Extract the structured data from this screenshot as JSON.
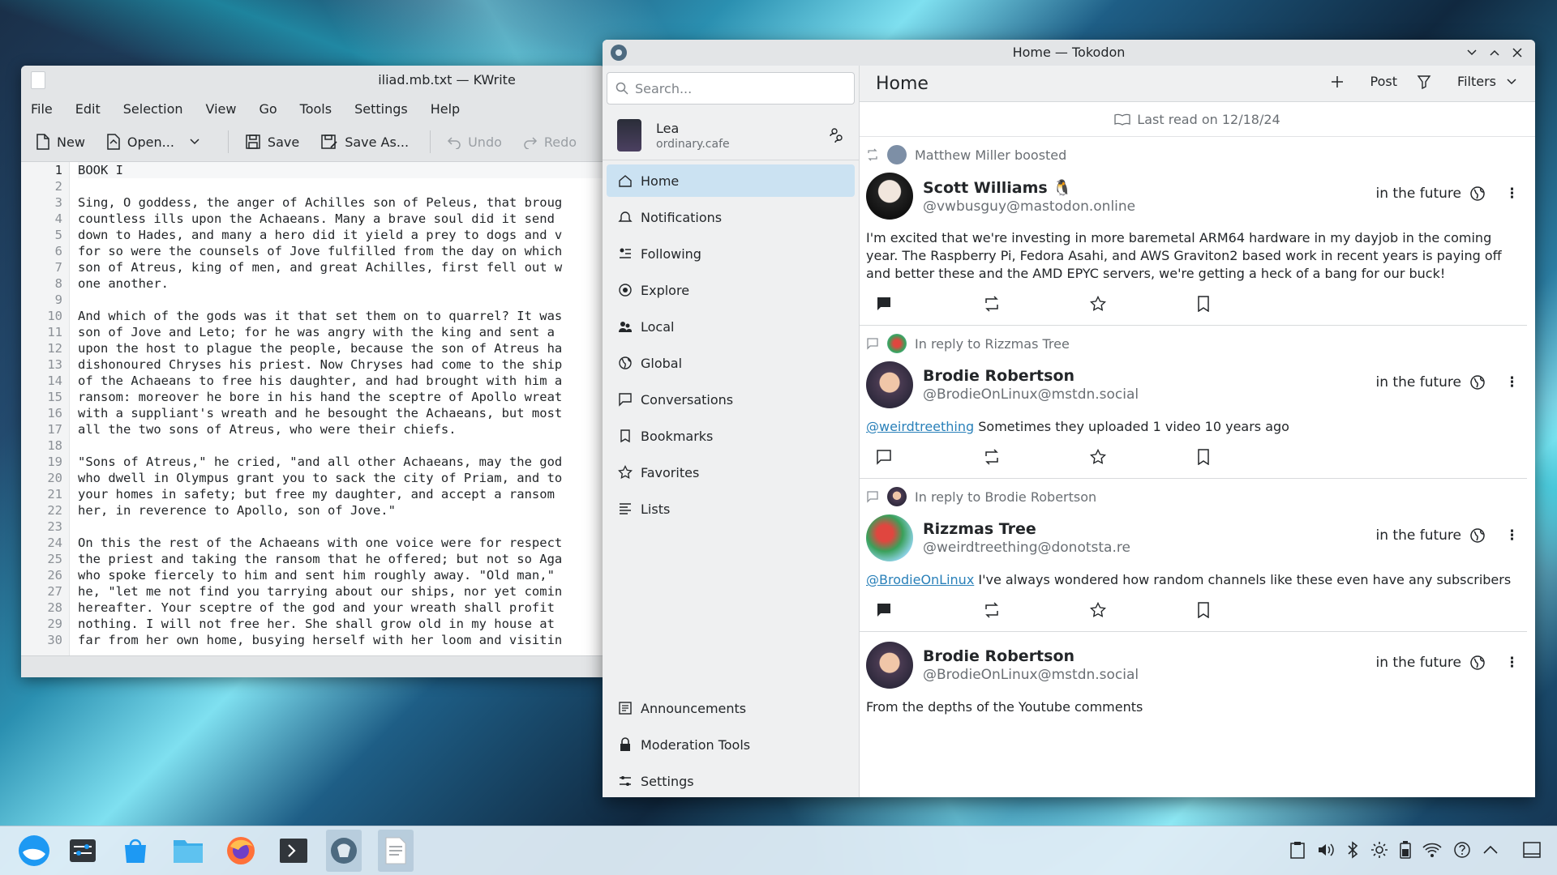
{
  "kwrite": {
    "title": "iliad.mb.txt — KWrite",
    "menu": [
      "File",
      "Edit",
      "Selection",
      "View",
      "Go",
      "Tools",
      "Settings",
      "Help"
    ],
    "toolbar": {
      "new_label": "New",
      "open_label": "Open...",
      "save_label": "Save",
      "save_as_label": "Save As...",
      "undo_label": "Undo",
      "redo_label": "Redo"
    },
    "lines": [
      "BOOK I",
      "",
      "Sing, O goddess, the anger of Achilles son of Peleus, that broug",
      "countless ills upon the Achaeans. Many a brave soul did it send",
      "down to Hades, and many a hero did it yield a prey to dogs and v",
      "for so were the counsels of Jove fulfilled from the day on which",
      "son of Atreus, king of men, and great Achilles, first fell out w",
      "one another.",
      "",
      "And which of the gods was it that set them on to quarrel? It was",
      "son of Jove and Leto; for he was angry with the king and sent a",
      "upon the host to plague the people, because the son of Atreus ha",
      "dishonoured Chryses his priest. Now Chryses had come to the ship",
      "of the Achaeans to free his daughter, and had brought with him a",
      "ransom: moreover he bore in his hand the sceptre of Apollo wreat",
      "with a suppliant's wreath and he besought the Achaeans, but most",
      "all the two sons of Atreus, who were their chiefs.",
      "",
      "\"Sons of Atreus,\" he cried, \"and all other Achaeans, may the god",
      "who dwell in Olympus grant you to sack the city of Priam, and to",
      "your homes in safety; but free my daughter, and accept a ransom",
      "her, in reverence to Apollo, son of Jove.\"",
      "",
      "On this the rest of the Achaeans with one voice were for respect",
      "the priest and taking the ransom that he offered; but not so Aga",
      "who spoke fiercely to him and sent him roughly away. \"Old man,\"",
      "he, \"let me not find you tarrying about our ships, nor yet comin",
      "hereafter. Your sceptre of the god and your wreath shall profit",
      "nothing. I will not free her. She shall grow old in my house at",
      "far from her own home, busying herself with her loom and visitin"
    ]
  },
  "tokodon": {
    "title": "Home — Tokodon",
    "search_placeholder": "Search...",
    "account": {
      "name": "Lea",
      "host": "ordinary.cafe"
    },
    "nav": [
      {
        "label": "Home",
        "icon": "home-icon"
      },
      {
        "label": "Notifications",
        "icon": "bell-icon"
      },
      {
        "label": "Following",
        "icon": "following-icon"
      },
      {
        "label": "Explore",
        "icon": "explore-icon"
      },
      {
        "label": "Local",
        "icon": "local-icon"
      },
      {
        "label": "Global",
        "icon": "globe-icon"
      },
      {
        "label": "Conversations",
        "icon": "conversation-icon"
      },
      {
        "label": "Bookmarks",
        "icon": "bookmark-icon"
      },
      {
        "label": "Favorites",
        "icon": "star-icon"
      },
      {
        "label": "Lists",
        "icon": "list-icon"
      }
    ],
    "nav_bottom": [
      {
        "label": "Announcements",
        "icon": "announcement-icon"
      },
      {
        "label": "Moderation Tools",
        "icon": "lock-icon"
      },
      {
        "label": "Settings",
        "icon": "settings-icon"
      }
    ],
    "header": {
      "title": "Home",
      "post_label": "Post",
      "filters_label": "Filters"
    },
    "last_read": "Last read on 12/18/24",
    "posts": [
      {
        "context": "Matthew Miller boosted",
        "name": "Scott Williams 🐧",
        "handle": "@vwbusguy@mastodon.online",
        "time": "in the future",
        "body": "I'm excited that we're investing in more baremetal ARM64 hardware in my dayjob in the coming year. The Raspberry Pi, Fedora Asahi, and AWS Graviton2 based work in recent years is paying off and better these and the AMD EPYC servers, we're getting a heck of a bang for our buck!"
      },
      {
        "context": "In reply to Rizzmas Tree",
        "name": "Brodie Robertson",
        "handle": "@BrodieOnLinux@mstdn.social",
        "time": "in the future",
        "mention": "@weirdtreething",
        "body": " Sometimes they uploaded 1 video 10 years ago"
      },
      {
        "context": "In reply to Brodie Robertson",
        "name": "Rizzmas Tree",
        "handle": "@weirdtreething@donotsta.re",
        "time": "in the future",
        "mention": "@BrodieOnLinux",
        "body": " I've always wondered how random channels like these even have any subscribers"
      },
      {
        "name": "Brodie Robertson",
        "handle": "@BrodieOnLinux@mstdn.social",
        "time": "in the future",
        "body": "From the depths of the Youtube comments"
      }
    ]
  },
  "colors": {
    "accent": "#2980b9",
    "active_nav": "#cbe2f2",
    "window_bg": "#eff0f1"
  }
}
